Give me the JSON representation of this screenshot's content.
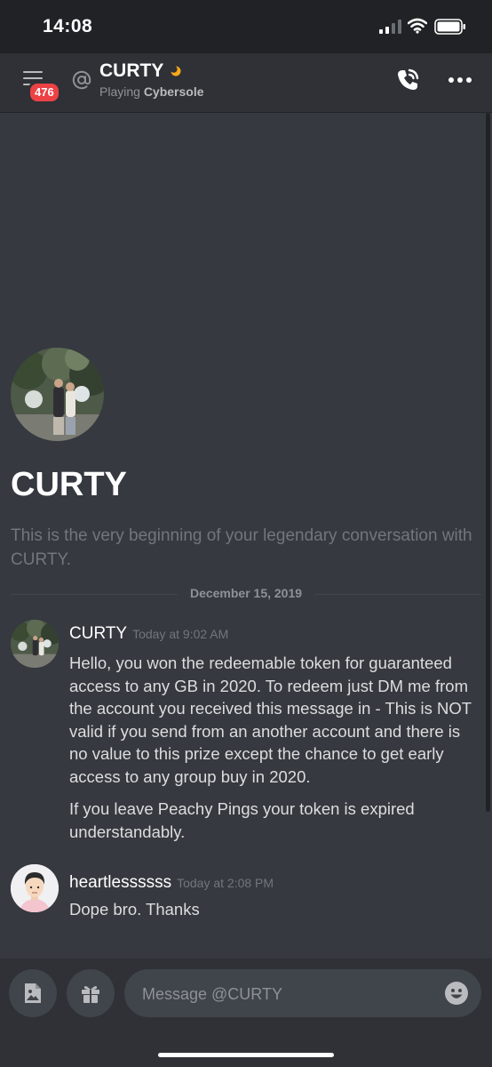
{
  "status_bar": {
    "time": "14:08"
  },
  "header": {
    "unread_badge": "476",
    "channel_name": "CURTY",
    "status_prefix": "Playing",
    "status_game": "Cybersole"
  },
  "welcome": {
    "title": "CURTY",
    "subtitle": "This is the very beginning of your legendary conversation with CURTY."
  },
  "date_divider": "December 15, 2019",
  "messages": [
    {
      "author": "CURTY",
      "timestamp": "Today at 9:02 AM",
      "paragraphs": [
        "Hello, you won the redeemable token for guaranteed access to any GB in 2020. To redeem just DM me from the account you received this message in - This is NOT valid if you send from an another account and there is no value to this prize except the chance to get early access to any group buy in 2020.",
        "If you leave Peachy Pings your token is expired understandably."
      ]
    },
    {
      "author": "heartlessssss",
      "timestamp": "Today at 2:08 PM",
      "paragraphs": [
        "Dope bro. Thanks"
      ]
    }
  ],
  "composer": {
    "placeholder": "Message @CURTY"
  },
  "icons": {
    "menu": "hamburger-menu-icon",
    "at": "at-sign-icon",
    "status": "idle-moon-icon",
    "call": "phone-call-icon",
    "more": "more-dots-icon",
    "image": "image-upload-icon",
    "gift": "gift-icon",
    "emoji": "emoji-icon"
  },
  "colors": {
    "accent": "#ed4245",
    "idle": "#faa81a",
    "background": "#36393f"
  }
}
